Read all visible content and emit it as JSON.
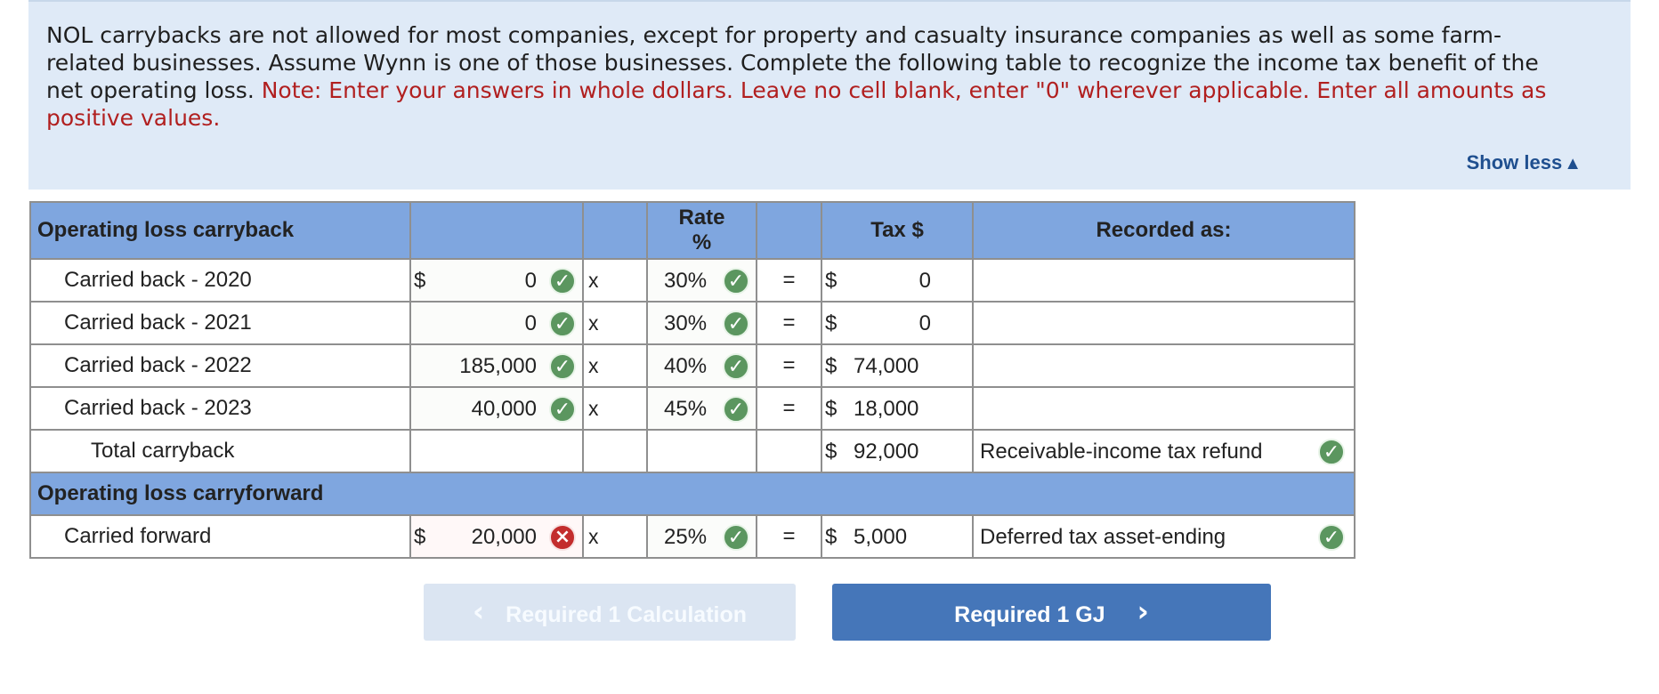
{
  "instructions": {
    "body": "NOL carrybacks are not allowed for most companies, except for property and casualty insurance companies as well as some farm-related businesses. Assume Wynn is one of those businesses. Complete the following table to recognize the income tax benefit of the net operating loss. ",
    "note": "Note: Enter your answers in whole dollars. Leave no cell blank, enter \"0\" wherever applicable. Enter all amounts as positive values.",
    "show_less_label": "Show less",
    "show_less_icon": "▲"
  },
  "table": {
    "headers": {
      "operating_loss_carryback": "Operating loss carryback",
      "rate_percent": "Rate\n%",
      "tax_dollar": "Tax $",
      "recorded_as": "Recorded as:"
    },
    "carryback_rows": [
      {
        "label": "Carried back - 2020",
        "dollar": "$",
        "amount": "0",
        "amount_status": "correct",
        "times": "x",
        "rate": "30%",
        "rate_status": "correct",
        "equals": "=",
        "tax_dollar": "$",
        "tax": "0"
      },
      {
        "label": "Carried back - 2021",
        "dollar": "",
        "amount": "0",
        "amount_status": "correct",
        "times": "x",
        "rate": "30%",
        "rate_status": "correct",
        "equals": "=",
        "tax_dollar": "$",
        "tax": "0"
      },
      {
        "label": "Carried back - 2022",
        "dollar": "",
        "amount": "185,000",
        "amount_status": "correct",
        "times": "x",
        "rate": "40%",
        "rate_status": "correct",
        "equals": "=",
        "tax_dollar": "$",
        "tax": "74,000"
      },
      {
        "label": "Carried back - 2023",
        "dollar": "",
        "amount": "40,000",
        "amount_status": "correct",
        "times": "x",
        "rate": "45%",
        "rate_status": "correct",
        "equals": "=",
        "tax_dollar": "$",
        "tax": "18,000"
      }
    ],
    "total": {
      "label": "Total carryback",
      "tax_dollar": "$",
      "tax": "92,000",
      "recorded_as": "Receivable-income tax refund",
      "status": "correct"
    },
    "carryforward_header": "Operating loss carryforward",
    "carryforward": {
      "label": "Carried forward",
      "dollar": "$",
      "amount": "20,000",
      "amount_status": "incorrect",
      "times": "x",
      "rate": "25%",
      "rate_status": "correct",
      "equals": "=",
      "tax_dollar": "$",
      "tax": "5,000",
      "recorded_as": "Deferred tax asset-ending",
      "status": "correct"
    }
  },
  "navigation": {
    "previous_label": "Required 1 Calculation",
    "next_label": "Required 1 GJ",
    "previous_icon": "chevron-left-icon",
    "next_icon": "chevron-right-icon",
    "next_color": "#4576b9",
    "previous_color": "#dbe5f2"
  },
  "status_icons": {
    "correct": "✓",
    "incorrect": "×",
    "correct_color": "#5b965f",
    "incorrect_color": "#c32d2d"
  }
}
